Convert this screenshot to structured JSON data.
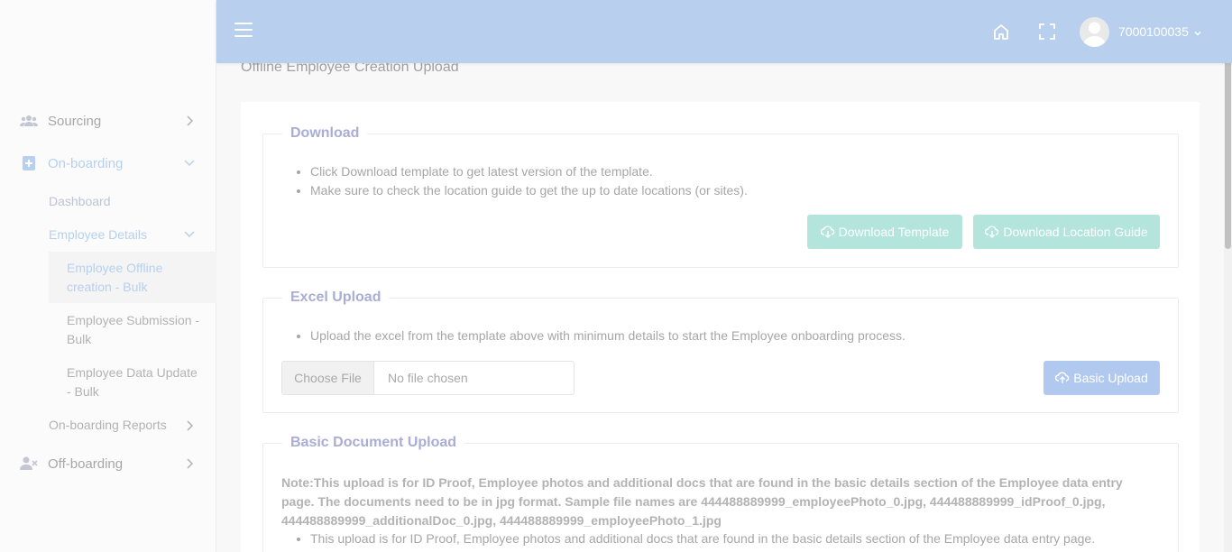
{
  "sidebar": {
    "items": [
      {
        "label": "Sourcing",
        "icon": "users-icon"
      },
      {
        "label": "On-boarding",
        "icon": "file-plus-icon"
      },
      {
        "label": "Off-boarding",
        "icon": "user-remove-icon"
      }
    ],
    "onboarding_sub": {
      "dashboard": "Dashboard",
      "employee_details": "Employee Details",
      "employee_offline_creation": "Employee Offline creation - Bulk",
      "employee_submission": "Employee Submission - Bulk",
      "employee_data_update": "Employee Data Update - Bulk",
      "onboarding_reports": "On-boarding Reports"
    },
    "accent_color": "#b7d0ef"
  },
  "header": {
    "user_name": "7000100035",
    "background": "#b8cfed"
  },
  "page": {
    "title": "Offline Employee Creation Upload"
  },
  "download": {
    "legend": "Download",
    "bullets": [
      "Click Download template to get latest version of the template.",
      "Make sure to check the location guide to get the up to date locations (or sites)."
    ],
    "download_template_label": "Download Template",
    "download_location_guide_label": "Download Location Guide"
  },
  "excel_upload": {
    "legend": "Excel Upload",
    "bullets": [
      "Upload the excel from the template above with minimum details to start the Employee onboarding process."
    ],
    "choose_file_label": "Choose File",
    "no_file_label": "No file chosen",
    "basic_upload_label": "Basic Upload"
  },
  "basic_document_upload": {
    "legend": "Basic Document Upload",
    "note": "Note:This upload is for ID Proof, Employee photos and additional docs that are found in the basic details section of the Employee data entry page. The documents need to be in jpg format. Sample file names are 444488889999_employeePhoto_0.jpg, 444488889999_idProof_0.jpg, 444488889999_additionalDoc_0.jpg, 444488889999_employeePhoto_1.jpg",
    "bullets": [
      "This upload is for ID Proof, Employee photos and additional docs that are found in the basic details section of the Employee data entry page."
    ]
  }
}
